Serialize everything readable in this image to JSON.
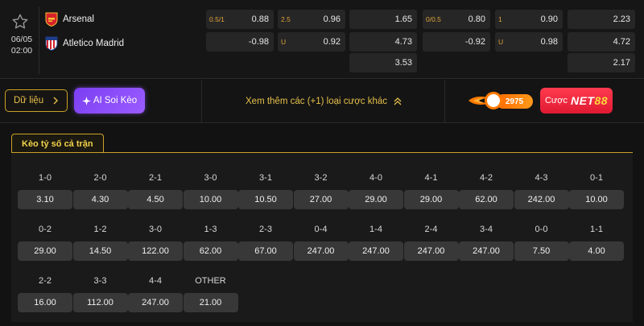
{
  "match": {
    "date": "06/05",
    "time": "02:00",
    "home": "Arsenal",
    "away": "Atletico Madrid",
    "rows": [
      [
        "0.5/1",
        "0.88",
        "2.5",
        "0.96",
        "",
        "1.65",
        "0/0.5",
        "0.80",
        "1",
        "0.90",
        "",
        "2.23"
      ],
      [
        "",
        "-0.98",
        "U",
        "0.92",
        "",
        "4.73",
        "",
        "-0.92",
        "U",
        "0.98",
        "",
        "4.72"
      ],
      [
        "",
        "",
        "",
        "",
        "",
        "3.53",
        "",
        "",
        "",
        "",
        "",
        "2.17"
      ]
    ]
  },
  "actions": {
    "data_label": "Dữ liệu",
    "ai_label": "AI Soi Kèo",
    "more_label": "Xem thêm các (+1) loại cược khác",
    "badge_count": "2975",
    "bet_label": "Cược",
    "brand_a": "NET",
    "brand_b": "88"
  },
  "section": {
    "tab_label": "Kèo tỷ số cả trận"
  },
  "scores": [
    {
      "score": "1-0",
      "odds": "3.10"
    },
    {
      "score": "2-0",
      "odds": "4.30"
    },
    {
      "score": "2-1",
      "odds": "4.50"
    },
    {
      "score": "3-0",
      "odds": "10.00"
    },
    {
      "score": "3-1",
      "odds": "10.50"
    },
    {
      "score": "3-2",
      "odds": "27.00"
    },
    {
      "score": "4-0",
      "odds": "29.00"
    },
    {
      "score": "4-1",
      "odds": "29.00"
    },
    {
      "score": "4-2",
      "odds": "62.00"
    },
    {
      "score": "4-3",
      "odds": "242.00"
    },
    {
      "score": "0-1",
      "odds": "10.00"
    },
    {
      "score": "0-2",
      "odds": "29.00"
    },
    {
      "score": "1-2",
      "odds": "14.50"
    },
    {
      "score": "3-0",
      "odds": "122.00"
    },
    {
      "score": "1-3",
      "odds": "62.00"
    },
    {
      "score": "2-3",
      "odds": "67.00"
    },
    {
      "score": "0-4",
      "odds": "247.00"
    },
    {
      "score": "1-4",
      "odds": "247.00"
    },
    {
      "score": "2-4",
      "odds": "247.00"
    },
    {
      "score": "3-4",
      "odds": "247.00"
    },
    {
      "score": "0-0",
      "odds": "7.50"
    },
    {
      "score": "1-1",
      "odds": "4.00"
    },
    {
      "score": "2-2",
      "odds": "16.00"
    },
    {
      "score": "3-3",
      "odds": "112.00"
    },
    {
      "score": "4-4",
      "odds": "247.00"
    },
    {
      "score": "OTHER",
      "odds": "21.00"
    }
  ],
  "colors": {
    "accent_gold": "#e6c04a",
    "line_orange": "#e0a43a",
    "ai_purple": "#8a4dff",
    "brand_red": "#ef2a3f"
  }
}
